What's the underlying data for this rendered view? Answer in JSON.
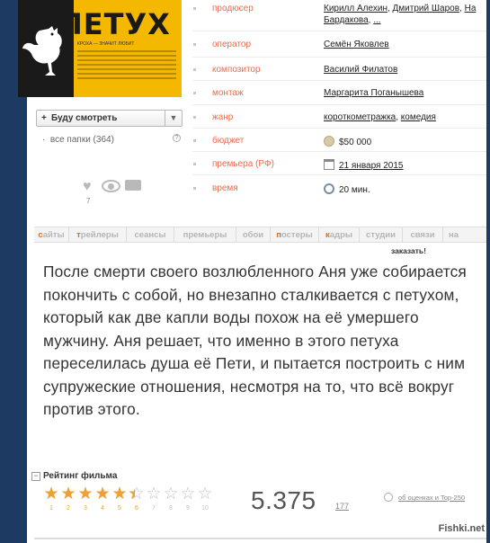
{
  "poster": {
    "title": "ПЕТУХ",
    "tagline": "КРОХА — ЗНАЧИТ ЛЮБИТ"
  },
  "watch": {
    "plus": "+",
    "label": "Буду смотреть",
    "folders": "все папки (364)"
  },
  "actions": {
    "count": "7"
  },
  "info": {
    "producer": {
      "key": "продюсер",
      "values": [
        "Кирилл Алехин",
        "Дмитрий Шаров",
        "На"
      ],
      "line2": "Бардакова",
      "more": "..."
    },
    "operator": {
      "key": "оператор",
      "value": "Семён Яковлев"
    },
    "composer": {
      "key": "композитор",
      "value": "Василий Филатов"
    },
    "editing": {
      "key": "монтаж",
      "value": "Маргарита Поганышева"
    },
    "genre": {
      "key": "жанр",
      "values": [
        "короткометражка",
        "комедия"
      ]
    },
    "budget": {
      "key": "бюджет",
      "value": "$50 000"
    },
    "premiere": {
      "key": "премьера (РФ)",
      "value": "21 января 2015"
    },
    "runtime": {
      "key": "время",
      "value": "20 мин."
    }
  },
  "tabs": [
    {
      "first": "с",
      "rest": "айты",
      "active": true
    },
    {
      "first": "т",
      "rest": "рейлеры",
      "active": true
    },
    {
      "first": "",
      "rest": "сеансы",
      "active": false
    },
    {
      "first": "",
      "rest": "премьеры",
      "active": false
    },
    {
      "first": "",
      "rest": "обои",
      "active": false
    },
    {
      "first": "п",
      "rest": "остеры",
      "active": true
    },
    {
      "first": "к",
      "rest": "адры",
      "active": true
    },
    {
      "first": "",
      "rest": "студии",
      "active": false
    },
    {
      "first": "",
      "rest": "связи",
      "active": false
    },
    {
      "first": "",
      "rest": "на",
      "active": false
    }
  ],
  "order_label": "заказать!",
  "description": "После смерти своего возлюбленного Аня уже собирается покончить с собой, но внезапно сталкивается с петухом, который как две капли воды похож на её умершего мужчину. Аня решает, что именно в этого петуха переселилась душа её Пети, и пытается построить с ним супружеские отношения, несмотря на то, что всё вокруг против этого.",
  "rating": {
    "collapse_icon": "minus-square-icon",
    "title": "Рейтинг фильма",
    "score": "5.375",
    "votes": "177",
    "max_stars": 10,
    "value": 5.375,
    "star_numbers": [
      "1",
      "2",
      "3",
      "4",
      "5",
      "6",
      "7",
      "8",
      "9",
      "10"
    ],
    "imdb_link": "об оценках и Top-250",
    "star_color": "#f0a030",
    "star_empty_color": "#c4c4c4"
  },
  "watermark": "Fishki.net",
  "colors": {
    "accent": "#f06a4a",
    "tab_highlight": "#f06a00",
    "frame": "#1d3a63"
  }
}
